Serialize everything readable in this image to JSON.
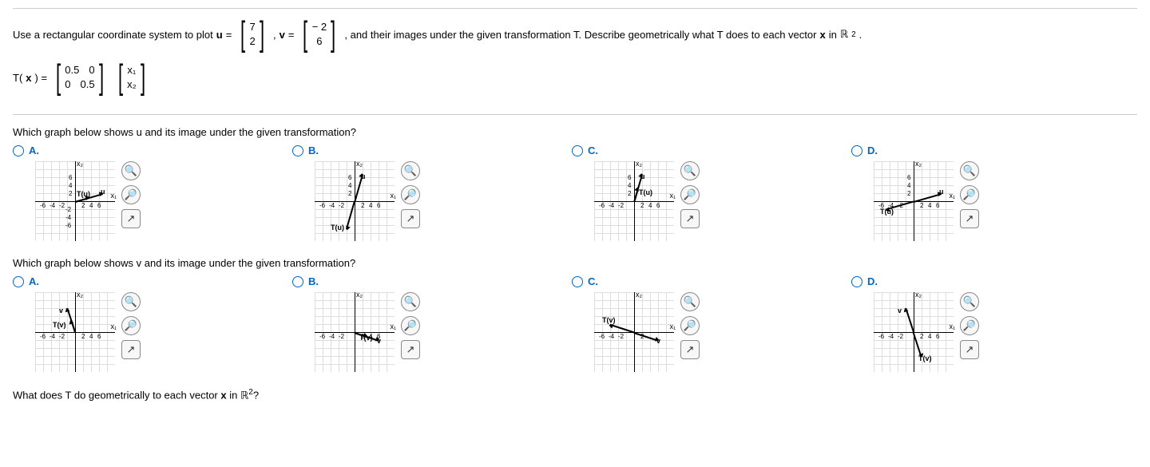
{
  "problem": {
    "intro_a": "Use a rectangular coordinate system to plot ",
    "u_label": "u",
    "eq": " = ",
    "u_col": [
      "7",
      "2"
    ],
    "comma_v": ", ",
    "v_label": "v",
    "v_col": [
      "− 2",
      "6"
    ],
    "intro_b": ", and their images under the given transformation T. Describe geometrically what T does to each vector ",
    "x_label": "x",
    "intro_c": " in ",
    "R": "ℝ",
    "sup2": "2",
    "period": "."
  },
  "transformation": {
    "T_label": "T(",
    "x": "x",
    "close": ") = ",
    "matrix_rows": [
      [
        "0.5",
        "0"
      ],
      [
        "0",
        "0.5"
      ]
    ],
    "xcol": [
      "x₁",
      "x₂"
    ]
  },
  "q1": "Which graph below shows u and its image under the given transformation?",
  "q2": "Which graph below shows v and its image under the given transformation?",
  "q3_a": "What does T do geometrically to each vector ",
  "q3_b": " in ",
  "options": [
    "A.",
    "B.",
    "C.",
    "D."
  ],
  "axis": {
    "y_label": "x₂",
    "x_label": "x₁",
    "ticks_pos": [
      "2",
      "4",
      "6"
    ],
    "ticks_neg": [
      "-2",
      "-4",
      "-6"
    ],
    "y_pos": [
      "2",
      "4",
      "6"
    ],
    "y_neg": [
      "-2",
      "-4",
      "-6"
    ]
  },
  "graph_labels": {
    "u": "u",
    "v": "v",
    "Tu": "T(u)",
    "Tv": "T(v)"
  },
  "tool_icons": {
    "zoom_in": "⊕",
    "zoom_out": "⊖",
    "popout": "⧉"
  }
}
